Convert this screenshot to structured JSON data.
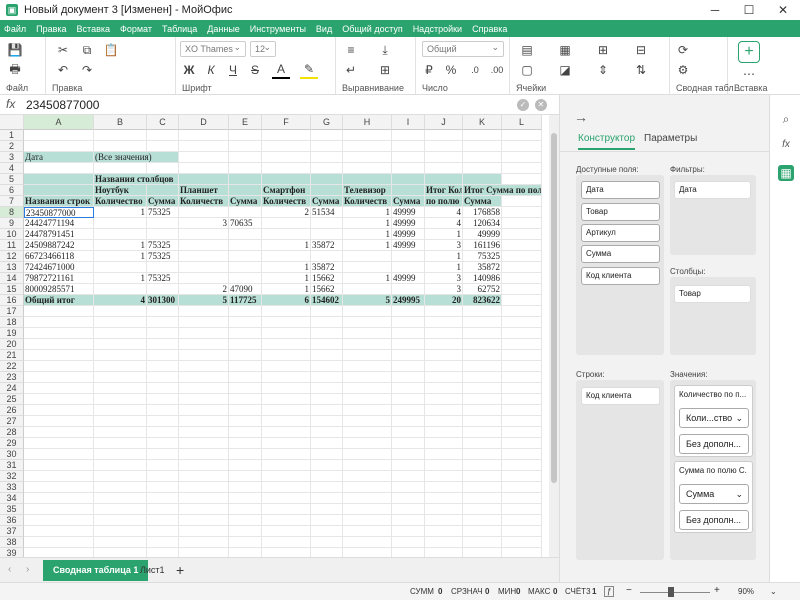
{
  "window": {
    "title": "Новый документ 3 [Изменен] - МойОфис",
    "minimize": "─",
    "maximize": "☐",
    "close": "✕"
  },
  "menu": [
    "Файл",
    "Правка",
    "Вставка",
    "Формат",
    "Таблица",
    "Данные",
    "Инструменты",
    "Вид",
    "Общий доступ",
    "Надстройки",
    "Справка"
  ],
  "ribbon": {
    "groups": {
      "file": "Файл",
      "edit": "Правка",
      "font": "Шрифт",
      "align": "Выравнивание",
      "number": "Число",
      "cells": "Ячейки",
      "pivot": "Сводная табл...",
      "insert": "Вставка"
    },
    "font_name": "XO Thames",
    "font_size": "12",
    "number_format": "Общий",
    "icons": {
      "save": "💾",
      "print": "🖶",
      "cut": "✂",
      "copy": "⧉",
      "paste": "📋",
      "undo": "↶",
      "redo": "↷",
      "bold": "Ж",
      "italic": "К",
      "underline": "Ч",
      "strike": "S",
      "color": "A",
      "highlight": "✎",
      "currency": "₽",
      "percent": "%"
    }
  },
  "formula": {
    "fx": "fx",
    "value": "23450877000"
  },
  "columns": [
    {
      "label": "A",
      "w": 70
    },
    {
      "label": "B",
      "w": 53
    },
    {
      "label": "C",
      "w": 32
    },
    {
      "label": "D",
      "w": 50
    },
    {
      "label": "E",
      "w": 33
    },
    {
      "label": "F",
      "w": 49
    },
    {
      "label": "G",
      "w": 32
    },
    {
      "label": "H",
      "w": 49
    },
    {
      "label": "I",
      "w": 33
    },
    {
      "label": "J",
      "w": 38
    },
    {
      "label": "K",
      "w": 39
    },
    {
      "label": "L",
      "w": 40
    }
  ],
  "rows": [
    "1",
    "2",
    "3",
    "4",
    "5",
    "6",
    "7",
    "8",
    "9",
    "10",
    "11",
    "12",
    "13",
    "14",
    "15",
    "16",
    "17",
    "18",
    "19",
    "20",
    "21",
    "22",
    "23",
    "24",
    "25",
    "26",
    "27",
    "28",
    "29",
    "30",
    "31",
    "32",
    "33",
    "34",
    "35",
    "36",
    "37",
    "38",
    "39"
  ],
  "cells": [
    {
      "r": 3,
      "c": 0,
      "t": "Дата",
      "cls": "teal"
    },
    {
      "r": 3,
      "c": 1,
      "t": "(Все значения)",
      "span": 2,
      "cls": "teal"
    },
    {
      "r": 5,
      "c": 0,
      "t": "",
      "cls": "teal"
    },
    {
      "r": 5,
      "c": 1,
      "t": "Названия столбцов",
      "span": 2,
      "cls": "teal bold"
    },
    {
      "r": 5,
      "c": 3,
      "t": "",
      "cls": "teal"
    },
    {
      "r": 5,
      "c": 4,
      "t": "",
      "cls": "teal"
    },
    {
      "r": 5,
      "c": 5,
      "t": "",
      "cls": "teal"
    },
    {
      "r": 5,
      "c": 6,
      "t": "",
      "cls": "teal"
    },
    {
      "r": 5,
      "c": 7,
      "t": "",
      "cls": "teal"
    },
    {
      "r": 5,
      "c": 8,
      "t": "",
      "cls": "teal"
    },
    {
      "r": 5,
      "c": 9,
      "t": "",
      "cls": "teal"
    },
    {
      "r": 5,
      "c": 10,
      "t": "",
      "cls": "teal"
    },
    {
      "r": 6,
      "c": 0,
      "t": "",
      "cls": "teal"
    },
    {
      "r": 6,
      "c": 1,
      "t": "Ноутбук",
      "cls": "teal bold"
    },
    {
      "r": 6,
      "c": 2,
      "t": "",
      "cls": "teal"
    },
    {
      "r": 6,
      "c": 3,
      "t": "Планшет",
      "cls": "teal bold"
    },
    {
      "r": 6,
      "c": 4,
      "t": "",
      "cls": "teal"
    },
    {
      "r": 6,
      "c": 5,
      "t": "Смартфон",
      "cls": "teal bold"
    },
    {
      "r": 6,
      "c": 6,
      "t": "",
      "cls": "teal"
    },
    {
      "r": 6,
      "c": 7,
      "t": "Телевизор",
      "cls": "teal bold"
    },
    {
      "r": 6,
      "c": 8,
      "t": "",
      "cls": "teal"
    },
    {
      "r": 6,
      "c": 9,
      "t": "Итог Коли",
      "cls": "teal bold"
    },
    {
      "r": 6,
      "c": 10,
      "t": "Итог Сумма по полю",
      "span": 2,
      "cls": "teal bold"
    },
    {
      "r": 7,
      "c": 0,
      "t": "Названия строк",
      "cls": "teal bold"
    },
    {
      "r": 7,
      "c": 1,
      "t": "Количество",
      "cls": "teal bold"
    },
    {
      "r": 7,
      "c": 2,
      "t": "Сумма",
      "cls": "teal bold"
    },
    {
      "r": 7,
      "c": 3,
      "t": "Количеств",
      "cls": "teal bold"
    },
    {
      "r": 7,
      "c": 4,
      "t": "Сумма",
      "cls": "teal bold"
    },
    {
      "r": 7,
      "c": 5,
      "t": "Количеств",
      "cls": "teal bold"
    },
    {
      "r": 7,
      "c": 6,
      "t": "Сумма",
      "cls": "teal bold"
    },
    {
      "r": 7,
      "c": 7,
      "t": "Количеств",
      "cls": "teal bold"
    },
    {
      "r": 7,
      "c": 8,
      "t": "Сумма",
      "cls": "teal bold"
    },
    {
      "r": 7,
      "c": 9,
      "t": "по полю",
      "cls": "teal bold"
    },
    {
      "r": 7,
      "c": 10,
      "t": "Сумма",
      "cls": "teal bold"
    },
    {
      "r": 8,
      "c": 0,
      "t": "23450877000",
      "sel": true
    },
    {
      "r": 8,
      "c": 1,
      "t": "1",
      "cls": "r"
    },
    {
      "r": 8,
      "c": 2,
      "t": "75325"
    },
    {
      "r": 8,
      "c": 5,
      "t": "2",
      "cls": "r"
    },
    {
      "r": 8,
      "c": 6,
      "t": "51534"
    },
    {
      "r": 8,
      "c": 7,
      "t": "1",
      "cls": "r"
    },
    {
      "r": 8,
      "c": 8,
      "t": "49999"
    },
    {
      "r": 8,
      "c": 9,
      "t": "4",
      "cls": "r"
    },
    {
      "r": 8,
      "c": 10,
      "t": "176858",
      "cls": "r"
    },
    {
      "r": 9,
      "c": 0,
      "t": "24424771194"
    },
    {
      "r": 9,
      "c": 3,
      "t": "3",
      "cls": "r"
    },
    {
      "r": 9,
      "c": 4,
      "t": "70635"
    },
    {
      "r": 9,
      "c": 7,
      "t": "1",
      "cls": "r"
    },
    {
      "r": 9,
      "c": 8,
      "t": "49999"
    },
    {
      "r": 9,
      "c": 9,
      "t": "4",
      "cls": "r"
    },
    {
      "r": 9,
      "c": 10,
      "t": "120634",
      "cls": "r"
    },
    {
      "r": 10,
      "c": 0,
      "t": "24478791451"
    },
    {
      "r": 10,
      "c": 7,
      "t": "1",
      "cls": "r"
    },
    {
      "r": 10,
      "c": 8,
      "t": "49999"
    },
    {
      "r": 10,
      "c": 9,
      "t": "1",
      "cls": "r"
    },
    {
      "r": 10,
      "c": 10,
      "t": "49999",
      "cls": "r"
    },
    {
      "r": 11,
      "c": 0,
      "t": "24509887242"
    },
    {
      "r": 11,
      "c": 1,
      "t": "1",
      "cls": "r"
    },
    {
      "r": 11,
      "c": 2,
      "t": "75325"
    },
    {
      "r": 11,
      "c": 5,
      "t": "1",
      "cls": "r"
    },
    {
      "r": 11,
      "c": 6,
      "t": "35872"
    },
    {
      "r": 11,
      "c": 7,
      "t": "1",
      "cls": "r"
    },
    {
      "r": 11,
      "c": 8,
      "t": "49999"
    },
    {
      "r": 11,
      "c": 9,
      "t": "3",
      "cls": "r"
    },
    {
      "r": 11,
      "c": 10,
      "t": "161196",
      "cls": "r"
    },
    {
      "r": 12,
      "c": 0,
      "t": "66723466118"
    },
    {
      "r": 12,
      "c": 1,
      "t": "1",
      "cls": "r"
    },
    {
      "r": 12,
      "c": 2,
      "t": "75325"
    },
    {
      "r": 12,
      "c": 9,
      "t": "1",
      "cls": "r"
    },
    {
      "r": 12,
      "c": 10,
      "t": "75325",
      "cls": "r"
    },
    {
      "r": 13,
      "c": 0,
      "t": "72424671000"
    },
    {
      "r": 13,
      "c": 5,
      "t": "1",
      "cls": "r"
    },
    {
      "r": 13,
      "c": 6,
      "t": "35872"
    },
    {
      "r": 13,
      "c": 9,
      "t": "1",
      "cls": "r"
    },
    {
      "r": 13,
      "c": 10,
      "t": "35872",
      "cls": "r"
    },
    {
      "r": 14,
      "c": 0,
      "t": "79872721161"
    },
    {
      "r": 14,
      "c": 1,
      "t": "1",
      "cls": "r"
    },
    {
      "r": 14,
      "c": 2,
      "t": "75325"
    },
    {
      "r": 14,
      "c": 5,
      "t": "1",
      "cls": "r"
    },
    {
      "r": 14,
      "c": 6,
      "t": "15662"
    },
    {
      "r": 14,
      "c": 7,
      "t": "1",
      "cls": "r"
    },
    {
      "r": 14,
      "c": 8,
      "t": "49999"
    },
    {
      "r": 14,
      "c": 9,
      "t": "3",
      "cls": "r"
    },
    {
      "r": 14,
      "c": 10,
      "t": "140986",
      "cls": "r"
    },
    {
      "r": 15,
      "c": 0,
      "t": "80009285571"
    },
    {
      "r": 15,
      "c": 3,
      "t": "2",
      "cls": "r"
    },
    {
      "r": 15,
      "c": 4,
      "t": "47090"
    },
    {
      "r": 15,
      "c": 5,
      "t": "1",
      "cls": "r"
    },
    {
      "r": 15,
      "c": 6,
      "t": "15662"
    },
    {
      "r": 15,
      "c": 9,
      "t": "3",
      "cls": "r"
    },
    {
      "r": 15,
      "c": 10,
      "t": "62752",
      "cls": "r"
    },
    {
      "r": 16,
      "c": 0,
      "t": "Общий итог",
      "cls": "teal bold"
    },
    {
      "r": 16,
      "c": 1,
      "t": "4",
      "cls": "teal bold r"
    },
    {
      "r": 16,
      "c": 2,
      "t": "301300",
      "cls": "teal bold"
    },
    {
      "r": 16,
      "c": 3,
      "t": "5",
      "cls": "teal bold r"
    },
    {
      "r": 16,
      "c": 4,
      "t": "117725",
      "cls": "teal bold"
    },
    {
      "r": 16,
      "c": 5,
      "t": "6",
      "cls": "teal bold r"
    },
    {
      "r": 16,
      "c": 6,
      "t": "154602",
      "cls": "teal bold"
    },
    {
      "r": 16,
      "c": 7,
      "t": "5",
      "cls": "teal bold r"
    },
    {
      "r": 16,
      "c": 8,
      "t": "249995",
      "cls": "teal bold"
    },
    {
      "r": 16,
      "c": 9,
      "t": "20",
      "cls": "teal bold r"
    },
    {
      "r": 16,
      "c": 10,
      "t": "823622",
      "cls": "teal bold r"
    }
  ],
  "sheets": {
    "active": "Сводная таблица 1",
    "other": "Лист1",
    "add": "+"
  },
  "status": {
    "sum_l": "СУММ",
    "sum": "0",
    "avg_l": "СРЗНАЧ",
    "avg": "0",
    "min_l": "МИН",
    "min": "0",
    "max_l": "МАКС",
    "max": "0",
    "count_l": "СЧЁТ3",
    "count": "1",
    "zoom": "90%",
    "zoom_minus": "−",
    "zoom_plus": "+"
  },
  "panel": {
    "back": "→",
    "tabs": [
      "Конструктор",
      "Параметры"
    ],
    "available_label": "Доступные поля:",
    "available": [
      "Дата",
      "Товар",
      "Артикул",
      "Сумма",
      "Код клиента"
    ],
    "filters_label": "Фильтры:",
    "filters": [
      "Дата"
    ],
    "columns_label": "Столбцы:",
    "columns": [
      "Товар"
    ],
    "rows_label": "Строки:",
    "rows": [
      "Код клиента"
    ],
    "values_label": "Значения:",
    "values": [
      {
        "title": "Количество по п...",
        "func": "Коли...ство",
        "extra": "Без дополн..."
      },
      {
        "title": "Сумма по полю С...",
        "func": "Сумма",
        "extra": "Без дополн..."
      }
    ]
  },
  "sidebar": {
    "search": "⌕",
    "fx": "fx",
    "pivot": "▦"
  },
  "colors": {
    "accent": "#2aa36e",
    "pivot_fill": "#b7dfd6"
  }
}
